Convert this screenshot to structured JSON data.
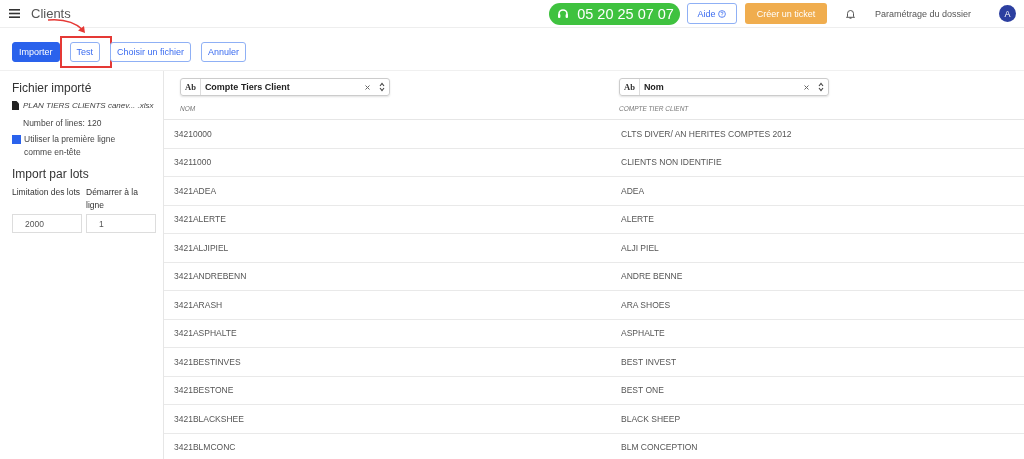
{
  "header": {
    "title": "Clients",
    "phone": "05 20 25 07 07",
    "help_button": "Aide",
    "ticket_button": "Créer un ticket",
    "settings_link": "Paramétrage du dossier",
    "avatar": "A"
  },
  "toolbar": [
    {
      "label": "Importer",
      "kind": "primary",
      "highlighted": false
    },
    {
      "label": "Test",
      "kind": "outline",
      "highlighted": true
    },
    {
      "label": "Choisir un fichier",
      "kind": "outline",
      "highlighted": false
    },
    {
      "label": "Annuler",
      "kind": "outline",
      "highlighted": false
    }
  ],
  "sidebar": {
    "file_heading": "Fichier importé",
    "file_name": "PLAN TIERS CLIENTS canev... .xlsx",
    "line_count": "Number of lines: 120",
    "header_checkbox": {
      "label": "Utiliser la première ligne comme en-tête",
      "checked": true
    },
    "batch_heading": "Import par lots",
    "fields": [
      {
        "label": "Limitation des lots",
        "value": "2000"
      },
      {
        "label": "Démarrer à la ligne",
        "value": "1"
      }
    ]
  },
  "table": {
    "columns": [
      {
        "type_badge": "Ab",
        "selected": "Compte Tiers Client",
        "caption": "NOM"
      },
      {
        "type_badge": "Ab",
        "selected": "Nom",
        "caption": "COMPTE TIER CLIENT"
      }
    ],
    "rows": [
      [
        "34210000",
        "CLTS DIVER/ AN HERITES COMPTES 2012"
      ],
      [
        "34211000",
        "CLIENTS NON IDENTIFIE"
      ],
      [
        "3421ADEA",
        "ADEA"
      ],
      [
        "3421ALERTE",
        "ALERTE"
      ],
      [
        "3421ALJIPIEL",
        "ALJI PIEL"
      ],
      [
        "3421ANDREBENN",
        "ANDRE BENNE"
      ],
      [
        "3421ARASH",
        "ARA SHOES"
      ],
      [
        "3421ASPHALTE",
        "ASPHALTE"
      ],
      [
        "3421BESTINVES",
        "BEST INVEST"
      ],
      [
        "3421BESTONE",
        "BEST ONE"
      ],
      [
        "3421BLACKSHEE",
        "BLACK SHEEP"
      ],
      [
        "3421BLMCONC",
        "BLM CONCEPTION"
      ]
    ]
  }
}
